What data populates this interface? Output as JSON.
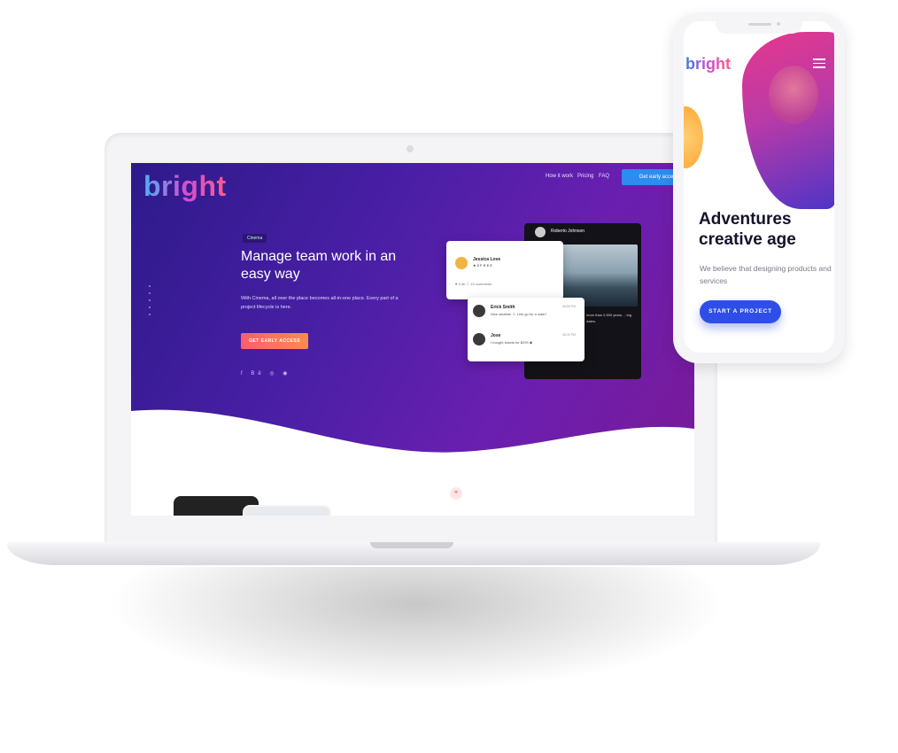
{
  "laptop": {
    "logo": "bright",
    "nav": [
      "How it work",
      "Pricing",
      "FAQ"
    ],
    "nav_cta": "Get early access",
    "badge": "Cinema",
    "headline": "Manage team work in an easy way",
    "subtext": "With Cinema, all over the place becomes all-in-one place. Every part of a project lifecycle is here.",
    "cta": "GET EARLY ACCESS",
    "socials": "f  Bē  ◎  ◉",
    "card_dark": {
      "name": "Roberto Johnson",
      "text": "more than 2,500 years. ...ing dates."
    },
    "card_white1": {
      "name": "Jessica Love",
      "stars": "★ 5 F R E E",
      "bar": "♥ 3.4k    ⓘ 15 comments"
    },
    "messages": [
      {
        "name": "Erick Smith",
        "text": "Nice weather ☺ Lets go for a walk?",
        "time": "08:56 PM"
      },
      {
        "name": "Jose",
        "text": "I bought tickets for $299 ◉",
        "time": "08:40 PM"
      }
    ],
    "fab_icon": "link-icon"
  },
  "phone": {
    "logo": "bright",
    "headline": "Adventures creative age",
    "subtext": "We believe that designing products and services",
    "cta": "START A PROJECT"
  }
}
